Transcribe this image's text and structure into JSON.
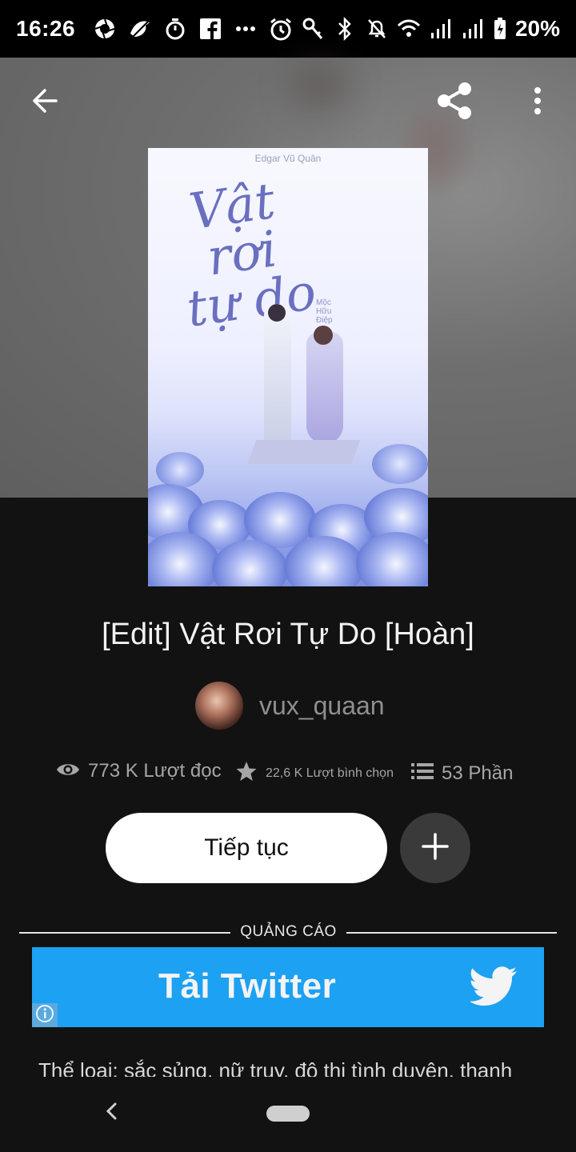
{
  "status_bar": {
    "time": "16:26",
    "battery_text": "20%",
    "left_icons": [
      "camera-aperture-icon",
      "bird-icon",
      "timer-icon",
      "facebook-icon",
      "more-dots-icon"
    ],
    "right_icons": [
      "alarm-icon",
      "key-icon",
      "bluetooth-icon",
      "mute-bell-icon",
      "wifi-icon",
      "signal-icon",
      "signal-icon",
      "battery-icon"
    ]
  },
  "toolbar": {
    "back_icon": "arrow-left-icon",
    "share_icon": "share-icon",
    "menu_icon": "more-vertical-icon"
  },
  "cover": {
    "author": "Edgar Vũ Quân",
    "title_line1": "Vật",
    "title_line2": "rơi",
    "title_line3": "tự do",
    "subtitle_lines": [
      "Mộc",
      "Hữu",
      "Điệp"
    ]
  },
  "book": {
    "title": "[Edit] Vật Rơi Tự Do [Hoàn]",
    "author": "vux_quaan"
  },
  "stats": {
    "reads": "773 K Lượt đọc",
    "votes": "22,6 K Lượt bình chọn",
    "parts": "53 Phần"
  },
  "actions": {
    "continue_label": "Tiếp tục",
    "add_icon": "plus-icon"
  },
  "ad": {
    "label": "QUẢNG CÁO",
    "banner_text": "Tải Twitter",
    "accent_color": "#1da1f2"
  },
  "description": {
    "text": "Thể loại: sắc sủng, nữ truy, đô thị tình duyên, thanh"
  },
  "colors": {
    "background": "#121212",
    "status_bar": "#000000",
    "button_bg": "#ffffff",
    "secondary_button_bg": "#3a3a3a"
  }
}
